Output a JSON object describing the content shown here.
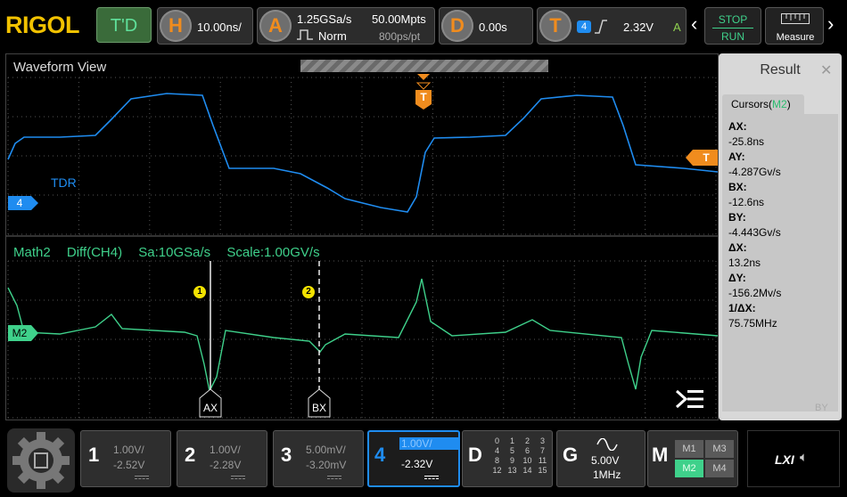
{
  "brand": "RIGOL",
  "top": {
    "td_label": "T'D",
    "h_label": "H",
    "h_value": "10.00ns/",
    "a_label": "A",
    "a_rate": "1.25GSa/s",
    "a_mode": "Norm",
    "a_points": "50.00Mpts",
    "a_ptrate": "800ps/pt",
    "d_label": "D",
    "d_value": "0.00s",
    "t_label": "T",
    "t_channel": "4",
    "t_value": "2.32V",
    "t_flag": "A",
    "stop": "STOP",
    "run": "RUN",
    "measure": "Measure"
  },
  "waveform": {
    "title": "Waveform View",
    "trigger_marker": "T",
    "ch4_label": "TDR",
    "ch4_marker": "4",
    "right_marker": "T",
    "math_header": "Math2",
    "math_func": "Diff(CH4)",
    "math_sa": "Sa:10GSa/s",
    "math_scale": "Scale:1.00GV/s",
    "math_marker": "M2",
    "cursor1": "1",
    "cursor2": "2",
    "ax_label": "AX",
    "bx_label": "BX",
    "by_faint": "BY"
  },
  "result": {
    "title": "Result",
    "tab": "Cursors(",
    "tab_m2": "M2",
    "tab_close": ")",
    "items": [
      {
        "k": "AX:",
        "v": "-25.8ns"
      },
      {
        "k": "AY:",
        "v": "-4.287Gv/s"
      },
      {
        "k": "BX:",
        "v": "-12.6ns"
      },
      {
        "k": "BY:",
        "v": "-4.443Gv/s"
      },
      {
        "k": "ΔX:",
        "v": "13.2ns"
      },
      {
        "k": "ΔY:",
        "v": "-156.2Mv/s"
      },
      {
        "k": "1/ΔX:",
        "v": "75.75MHz"
      }
    ]
  },
  "bottom": {
    "ch1": {
      "num": "1",
      "v1": "1.00V/",
      "v2": "-2.52V"
    },
    "ch2": {
      "num": "2",
      "v1": "1.00V/",
      "v2": "-2.28V"
    },
    "ch3": {
      "num": "3",
      "v1": "5.00mV/",
      "v2": "-3.20mV"
    },
    "ch4": {
      "num": "4",
      "v1": "1.00V/",
      "v2": "-2.32V"
    },
    "d": {
      "label": "D",
      "grid": [
        "0",
        "1",
        "2",
        "3",
        "4",
        "5",
        "6",
        "7",
        "8",
        "9",
        "10",
        "11",
        "12",
        "13",
        "14",
        "15"
      ]
    },
    "g": {
      "label": "G",
      "v1": "5.00V",
      "v2": "1MHz"
    },
    "m": {
      "label": "M",
      "items": [
        "M1",
        "M3",
        "M2",
        "M4"
      ]
    },
    "lxi": "LXI"
  },
  "colors": {
    "ch4": "#1f8cf0",
    "math": "#3fd18b",
    "trigger": "#f08c1e",
    "cursor_label": "#f2e200"
  }
}
